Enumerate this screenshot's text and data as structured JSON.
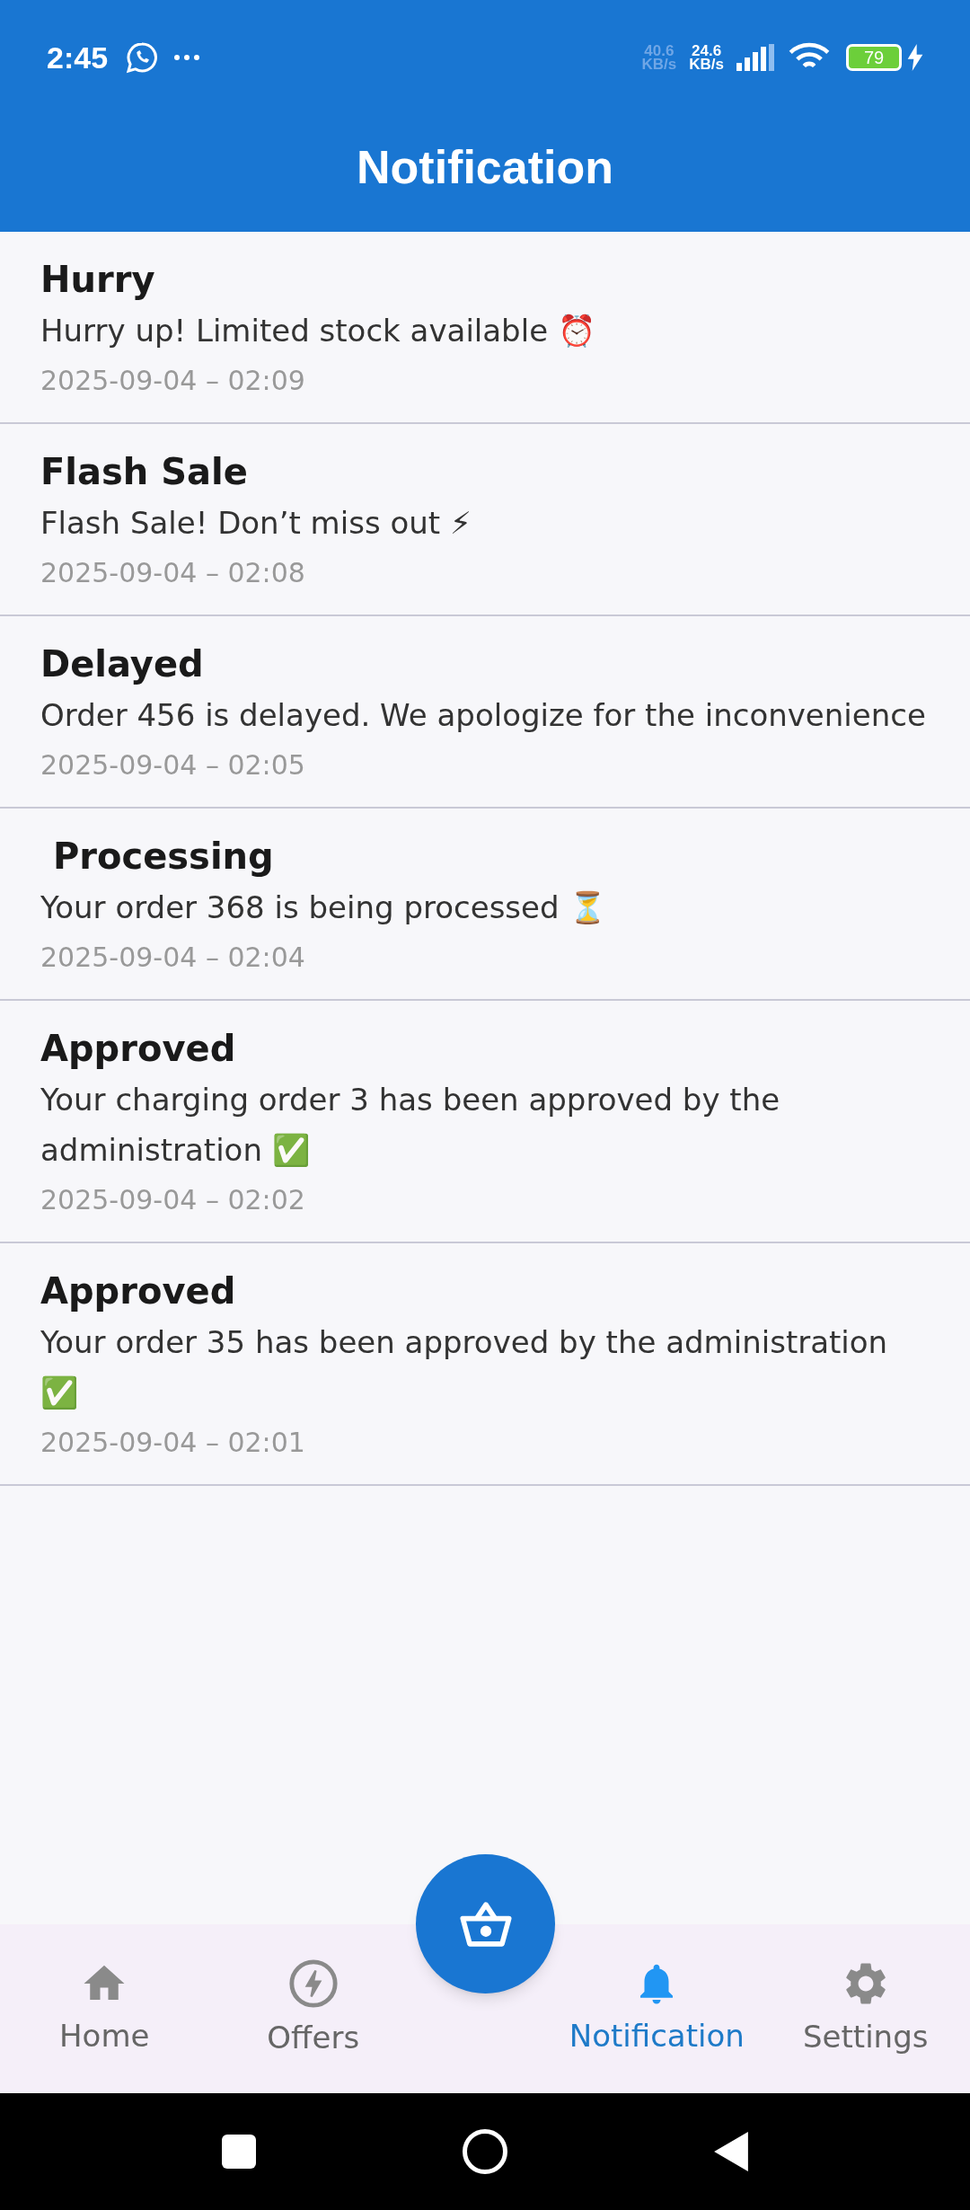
{
  "status_bar": {
    "time": "2:45",
    "speeds": [
      {
        "value": "40.6",
        "unit": "KB/s",
        "dim": true
      },
      {
        "value": "24.6",
        "unit": "KB/s",
        "dim": false
      }
    ],
    "battery": "79",
    "charging": true
  },
  "header": {
    "title": "Notification"
  },
  "notifications": [
    {
      "title": "Hurry",
      "message": "Hurry up! Limited stock available ⏰",
      "time": "2025-09-04 – 02:09"
    },
    {
      "title": "Flash Sale",
      "message": "Flash Sale! Don’t miss out ⚡",
      "time": "2025-09-04 – 02:08"
    },
    {
      "title": "Delayed",
      "message": "Order 456 is delayed. We apologize for the inconvenience",
      "time": "2025-09-04 – 02:05"
    },
    {
      "title": " Processing",
      "message": "Your order 368 is being processed ⏳",
      "time": "2025-09-04 – 02:04"
    },
    {
      "title": "Approved",
      "message": "Your charging order 3 has been approved by the administration ✅",
      "time": "2025-09-04 – 02:02"
    },
    {
      "title": "Approved",
      "message": "Your order 35 has been approved by the administration ✅",
      "time": "2025-09-04 – 02:01"
    }
  ],
  "bottom_nav": [
    {
      "label": "Home",
      "kind": "home",
      "selected": false
    },
    {
      "label": "Offers",
      "kind": "offers",
      "selected": false
    },
    {
      "label": "Notification",
      "kind": "notification",
      "selected": true
    },
    {
      "label": "Settings",
      "kind": "settings",
      "selected": false
    }
  ]
}
